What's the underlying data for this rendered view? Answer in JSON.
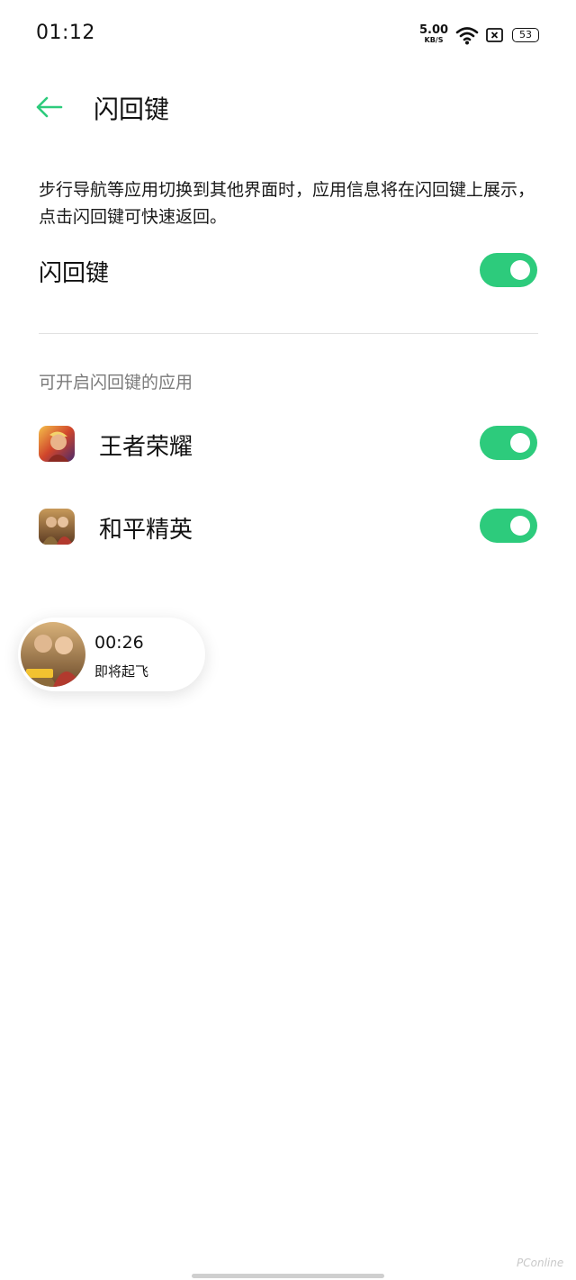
{
  "status_bar": {
    "time": "01:12",
    "net_speed_value": "5.00",
    "net_speed_unit": "KB/S",
    "battery_level": "53",
    "icons": [
      "wifi-icon",
      "sim-icon",
      "battery-icon"
    ]
  },
  "header": {
    "back_icon": "arrow-left-icon",
    "title": "闪回键"
  },
  "description": "步行导航等应用切换到其他界面时，应用信息将在闪回键上展示，点击闪回键可快速返回。",
  "main_toggle": {
    "label": "闪回键",
    "enabled": true
  },
  "apps_section": {
    "title": "可开启闪回键的应用",
    "apps": [
      {
        "name": "王者荣耀",
        "enabled": true
      },
      {
        "name": "和平精英",
        "enabled": true
      }
    ]
  },
  "floating_bubble": {
    "timer": "00:26",
    "status": "即将起飞"
  },
  "watermark": "PConline",
  "colors": {
    "accent": "#2dcb7c",
    "divider": "#e1e1e1",
    "secondary_text": "#7a7a7a"
  }
}
